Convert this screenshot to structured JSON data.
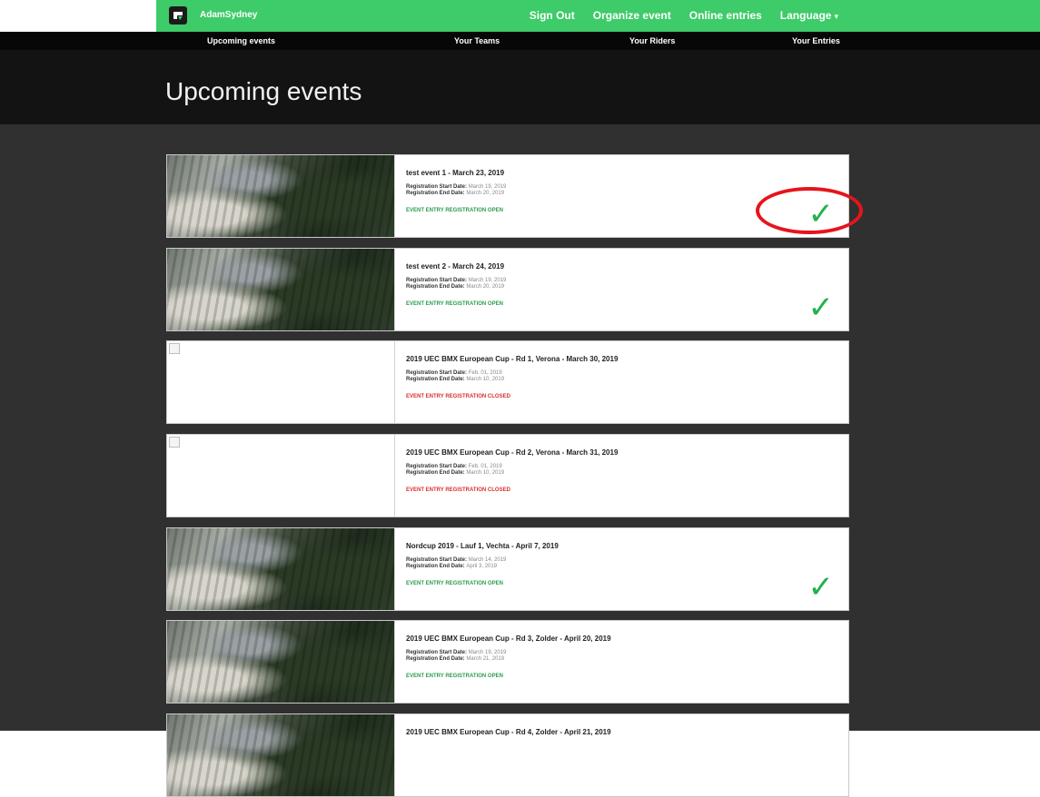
{
  "brand": {
    "name": "AdamSydney"
  },
  "top_nav": {
    "sign_out": "Sign Out",
    "organize_event": "Organize event",
    "online_entries": "Online entries",
    "language": "Language"
  },
  "sub_nav": {
    "upcoming_events": "Upcoming events",
    "your_teams": "Your Teams",
    "your_riders": "Your Riders",
    "your_entries": "Your Entries"
  },
  "page": {
    "title": "Upcoming events"
  },
  "labels": {
    "registration_start": "Registration Start Date:",
    "registration_end": "Registration End Date:"
  },
  "colors": {
    "brand_green": "#3ecb69",
    "open_green": "#2e9b4e",
    "closed_red": "#d93030",
    "check_green": "#22b14c",
    "annotation_red": "#e6141b"
  },
  "events": [
    {
      "title": "test event 1 - March 23, 2019",
      "start": "March 19, 2019",
      "end": "March 20, 2019",
      "status": "EVENT ENTRY REGISTRATION OPEN",
      "open": true,
      "checked": true,
      "image": true
    },
    {
      "title": "test event 2 - March 24, 2019",
      "start": "March 19, 2019",
      "end": "March 20, 2019",
      "status": "EVENT ENTRY REGISTRATION OPEN",
      "open": true,
      "checked": true,
      "image": true
    },
    {
      "title": "2019 UEC BMX European Cup - Rd 1, Verona - March 30, 2019",
      "start": "Feb. 01, 2019",
      "end": "March 10, 2019",
      "status": "EVENT ENTRY REGISTRATION CLOSED",
      "open": false,
      "checked": false,
      "image": false
    },
    {
      "title": "2019 UEC BMX European Cup - Rd 2, Verona - March 31, 2019",
      "start": "Feb. 01, 2019",
      "end": "March 10, 2019",
      "status": "EVENT ENTRY REGISTRATION CLOSED",
      "open": false,
      "checked": false,
      "image": false
    },
    {
      "title": "Nordcup 2019 - Lauf 1, Vechta - April 7, 2019",
      "start": "March 14, 2019",
      "end": "April 3, 2019",
      "status": "EVENT ENTRY REGISTRATION OPEN",
      "open": true,
      "checked": true,
      "image": true
    },
    {
      "title": "2019 UEC BMX European Cup - Rd 3, Zolder - April 20, 2019",
      "start": "March 19, 2019",
      "end": "March 21, 2019",
      "status": "EVENT ENTRY REGISTRATION OPEN",
      "open": true,
      "checked": false,
      "image": true
    },
    {
      "title": "2019 UEC BMX European Cup - Rd 4, Zolder - April 21, 2019",
      "start": "",
      "end": "",
      "status": "",
      "open": true,
      "checked": false,
      "image": true
    }
  ]
}
